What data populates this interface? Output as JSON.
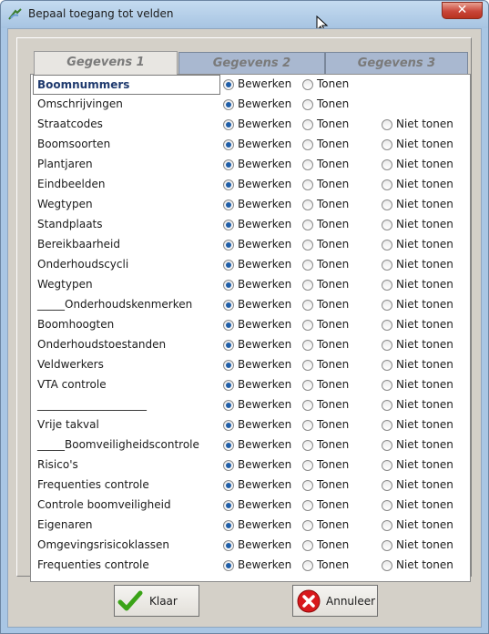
{
  "window": {
    "title": "Bepaal toegang tot velden",
    "close_label": "✕"
  },
  "tabs": [
    {
      "label": "Gegevens 1"
    },
    {
      "label": "Gegevens 2"
    },
    {
      "label": "Gegevens 3"
    }
  ],
  "options": {
    "edit": "Bewerken",
    "show": "Tonen",
    "hide": "Niet tonen"
  },
  "fields": [
    {
      "name": "Boomnummers",
      "selected": "edit",
      "has_hide": false
    },
    {
      "name": "Omschrijvingen",
      "selected": "edit",
      "has_hide": false
    },
    {
      "name": "Straatcodes",
      "selected": "edit",
      "has_hide": true
    },
    {
      "name": "Boomsoorten",
      "selected": "edit",
      "has_hide": true
    },
    {
      "name": "Plantjaren",
      "selected": "edit",
      "has_hide": true
    },
    {
      "name": "Eindbeelden",
      "selected": "edit",
      "has_hide": true
    },
    {
      "name": "Wegtypen",
      "selected": "edit",
      "has_hide": true
    },
    {
      "name": "Standplaats",
      "selected": "edit",
      "has_hide": true
    },
    {
      "name": "Bereikbaarheid",
      "selected": "edit",
      "has_hide": true
    },
    {
      "name": "Onderhoudscycli",
      "selected": "edit",
      "has_hide": true
    },
    {
      "name": "Wegtypen",
      "selected": "edit",
      "has_hide": true
    },
    {
      "name": "_____Onderhoudskenmerken",
      "selected": "edit",
      "has_hide": true
    },
    {
      "name": "Boomhoogten",
      "selected": "edit",
      "has_hide": true
    },
    {
      "name": "Onderhoudstoestanden",
      "selected": "edit",
      "has_hide": true
    },
    {
      "name": "Veldwerkers",
      "selected": "edit",
      "has_hide": true
    },
    {
      "name": "VTA controle",
      "selected": "edit",
      "has_hide": true
    },
    {
      "name": "____________________",
      "selected": "edit",
      "has_hide": true
    },
    {
      "name": "Vrije takval",
      "selected": "edit",
      "has_hide": true
    },
    {
      "name": "_____Boomveiligheidscontrole",
      "selected": "edit",
      "has_hide": true
    },
    {
      "name": "Risico's",
      "selected": "edit",
      "has_hide": true
    },
    {
      "name": "Frequenties controle",
      "selected": "edit",
      "has_hide": true
    },
    {
      "name": "Controle boomveiligheid",
      "selected": "edit",
      "has_hide": true
    },
    {
      "name": "Eigenaren",
      "selected": "edit",
      "has_hide": true
    },
    {
      "name": "Omgevingsrisicoklassen",
      "selected": "edit",
      "has_hide": true
    },
    {
      "name": "Frequenties controle",
      "selected": "edit",
      "has_hide": true
    }
  ],
  "buttons": {
    "ok": "Klaar",
    "cancel": "Annuleer"
  },
  "colors": {
    "radio_on": "#1f5ea8",
    "ok_icon": "#3aa317",
    "cancel_icon": "#d8181c"
  }
}
